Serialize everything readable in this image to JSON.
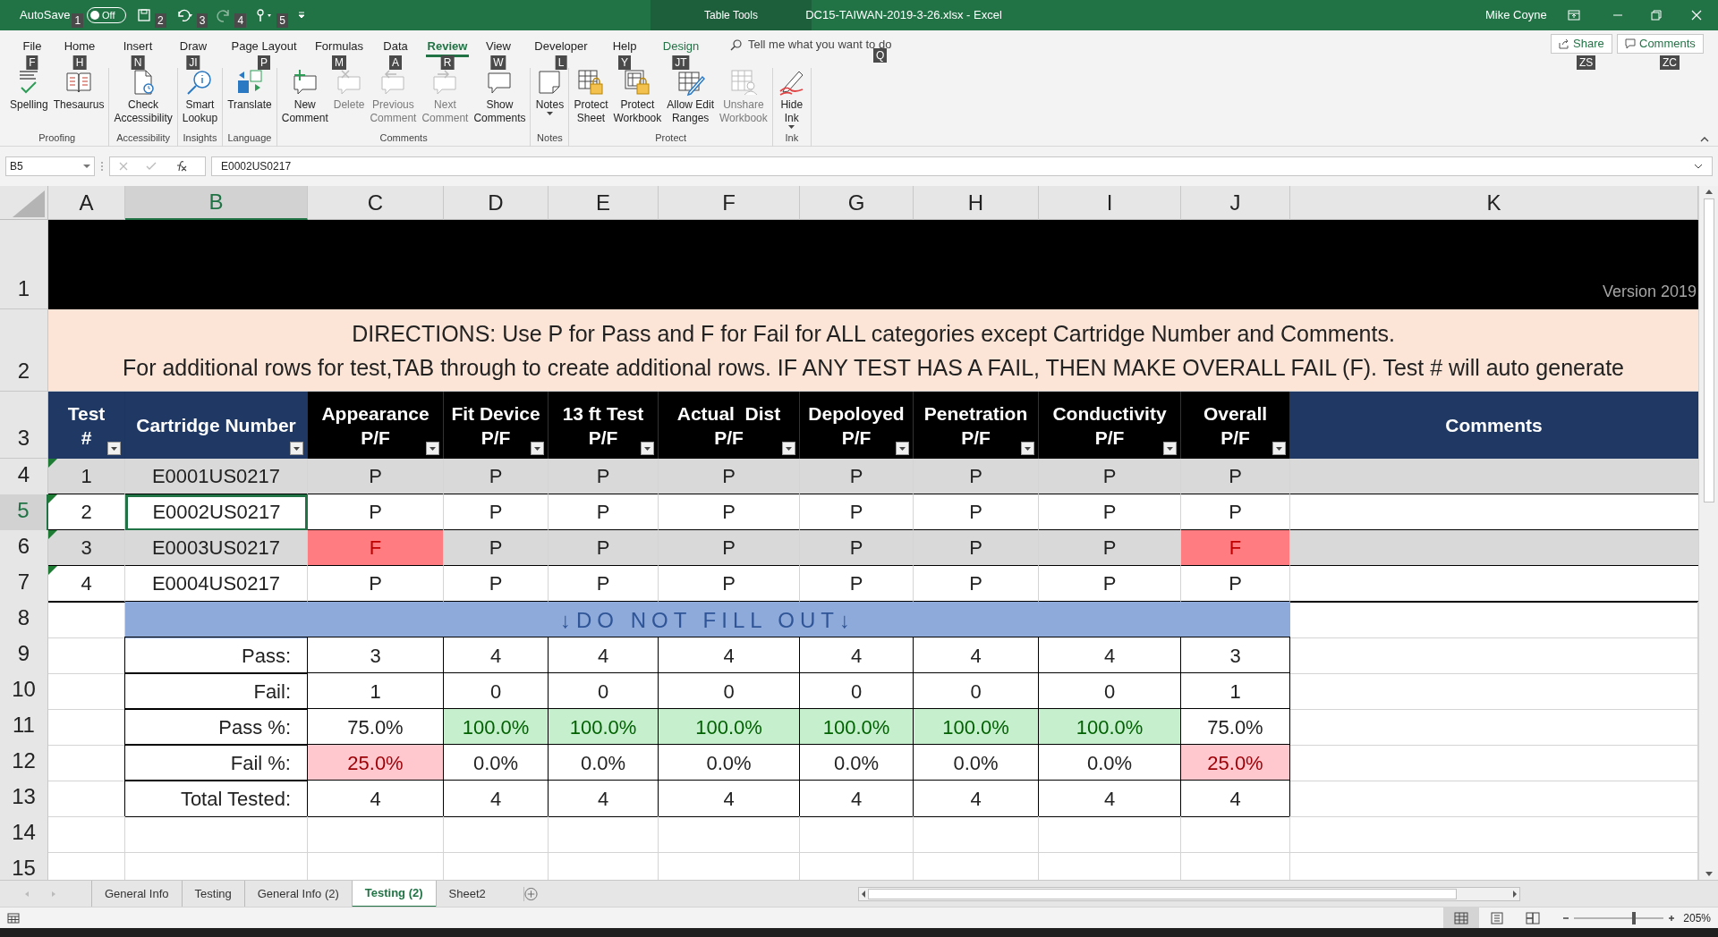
{
  "title_bar": {
    "autosave_label": "AutoSave",
    "autosave_state": "Off",
    "autosave_on": false,
    "qat_keys": [
      "1",
      "2",
      "3",
      "4",
      "5"
    ],
    "context_label": "Table Tools",
    "title": "DC15-TAIWAN-2019-3-26.xlsx  -  Excel",
    "user": "Mike Coyne"
  },
  "ribbon_tabs": [
    {
      "label": "File",
      "key": "F",
      "selected": false,
      "contextual": false
    },
    {
      "label": "Home",
      "key": "H",
      "selected": false,
      "contextual": false
    },
    {
      "label": "Insert",
      "key": "N",
      "selected": false,
      "contextual": false
    },
    {
      "label": "Draw",
      "key": "JI",
      "selected": false,
      "contextual": false
    },
    {
      "label": "Page Layout",
      "key": "P",
      "selected": false,
      "contextual": false
    },
    {
      "label": "Formulas",
      "key": "M",
      "selected": false,
      "contextual": false
    },
    {
      "label": "Data",
      "key": "A",
      "selected": false,
      "contextual": false
    },
    {
      "label": "Review",
      "key": "R",
      "selected": true,
      "contextual": false
    },
    {
      "label": "View",
      "key": "W",
      "selected": false,
      "contextual": false
    },
    {
      "label": "Developer",
      "key": "L",
      "selected": false,
      "contextual": false
    },
    {
      "label": "Help",
      "key": "Y",
      "selected": false,
      "contextual": false
    },
    {
      "label": "Design",
      "key": "JT",
      "selected": false,
      "contextual": true
    }
  ],
  "tell_me": {
    "placeholder": "Tell me what you want to do",
    "key": "Q"
  },
  "share": {
    "label": "Share",
    "key": "ZS"
  },
  "comments_button": {
    "label": "Comments",
    "key": "ZC"
  },
  "ribbon_groups": [
    {
      "label": "Proofing",
      "buttons": [
        {
          "label": "Spelling",
          "disabled": false,
          "dropdown": false
        },
        {
          "label": "Thesaurus",
          "disabled": false,
          "dropdown": false
        }
      ]
    },
    {
      "label": "Accessibility",
      "buttons": [
        {
          "label": "Check\nAccessibility",
          "disabled": false,
          "dropdown": false
        }
      ]
    },
    {
      "label": "Insights",
      "buttons": [
        {
          "label": "Smart\nLookup",
          "disabled": false,
          "dropdown": false
        }
      ]
    },
    {
      "label": "Language",
      "buttons": [
        {
          "label": "Translate",
          "disabled": false,
          "dropdown": false
        }
      ]
    },
    {
      "label": "Comments",
      "buttons": [
        {
          "label": "New\nComment",
          "disabled": false,
          "dropdown": false
        },
        {
          "label": "Delete",
          "disabled": true,
          "dropdown": false
        },
        {
          "label": "Previous\nComment",
          "disabled": true,
          "dropdown": false
        },
        {
          "label": "Next\nComment",
          "disabled": true,
          "dropdown": false
        },
        {
          "label": "Show\nComments",
          "disabled": false,
          "dropdown": false
        }
      ]
    },
    {
      "label": "Notes",
      "buttons": [
        {
          "label": "Notes",
          "disabled": false,
          "dropdown": true
        }
      ]
    },
    {
      "label": "Protect",
      "buttons": [
        {
          "label": "Protect\nSheet",
          "disabled": false,
          "dropdown": false
        },
        {
          "label": "Protect\nWorkbook",
          "disabled": false,
          "dropdown": false
        },
        {
          "label": "Allow Edit\nRanges",
          "disabled": false,
          "dropdown": false
        },
        {
          "label": "Unshare\nWorkbook",
          "disabled": true,
          "dropdown": false
        }
      ]
    },
    {
      "label": "Ink",
      "buttons": [
        {
          "label": "Hide\nInk",
          "disabled": false,
          "dropdown": true
        }
      ]
    }
  ],
  "formula_bar": {
    "name_box": "B5",
    "formula": "E0002US0217"
  },
  "columns": [
    {
      "label": "A",
      "selected": false
    },
    {
      "label": "B",
      "selected": true
    },
    {
      "label": "C",
      "selected": false
    },
    {
      "label": "D",
      "selected": false
    },
    {
      "label": "E",
      "selected": false
    },
    {
      "label": "F",
      "selected": false
    },
    {
      "label": "G",
      "selected": false
    },
    {
      "label": "H",
      "selected": false
    },
    {
      "label": "I",
      "selected": false
    },
    {
      "label": "J",
      "selected": false
    },
    {
      "label": "K",
      "selected": false
    }
  ],
  "row_numbers": [
    {
      "label": "1",
      "selected": false
    },
    {
      "label": "2",
      "selected": false
    },
    {
      "label": "3",
      "selected": false
    },
    {
      "label": "4",
      "selected": false
    },
    {
      "label": "5",
      "selected": true
    },
    {
      "label": "6",
      "selected": false
    },
    {
      "label": "7",
      "selected": false
    },
    {
      "label": "8",
      "selected": false
    },
    {
      "label": "9",
      "selected": false
    },
    {
      "label": "10",
      "selected": false
    },
    {
      "label": "11",
      "selected": false
    },
    {
      "label": "12",
      "selected": false
    },
    {
      "label": "13",
      "selected": false
    },
    {
      "label": "14",
      "selected": false
    },
    {
      "label": "15",
      "selected": false
    }
  ],
  "version": "Version 2019",
  "directions": [
    "DIRECTIONS: Use P for Pass and F for Fail for ALL categories except Cartridge Number and Comments.",
    "For additional rows for test,TAB through to create additional rows. IF ANY TEST HAS A FAIL, THEN MAKE OVERALL FAIL (F). Test # will auto generate"
  ],
  "table_headers": [
    {
      "lines": [
        "Test",
        "#"
      ],
      "color": "#1f3864",
      "filter": true
    },
    {
      "lines": [
        "Cartridge Number"
      ],
      "color": "#1f3864",
      "filter": true
    },
    {
      "lines": [
        "Appearance",
        "P/F"
      ],
      "color": "#000000",
      "filter": true
    },
    {
      "lines": [
        "Fit Device",
        "P/F"
      ],
      "color": "#000000",
      "filter": true
    },
    {
      "lines": [
        "13 ft Test",
        "P/F"
      ],
      "color": "#000000",
      "filter": true
    },
    {
      "lines": [
        "Actual  Dist",
        "P/F"
      ],
      "color": "#000000",
      "filter": true
    },
    {
      "lines": [
        "Depoloyed",
        "P/F"
      ],
      "color": "#000000",
      "filter": true
    },
    {
      "lines": [
        "Penetration",
        "P/F"
      ],
      "color": "#000000",
      "filter": true
    },
    {
      "lines": [
        "Conductivity",
        "P/F"
      ],
      "color": "#000000",
      "filter": true
    },
    {
      "lines": [
        "Overall",
        "P/F"
      ],
      "color": "#000000",
      "filter": true
    },
    {
      "lines": [
        "Comments"
      ],
      "color": "#1f3864",
      "filter": false
    }
  ],
  "rows": [
    {
      "test": "1",
      "cartridge": "E0001US0217",
      "banded": true,
      "results": [
        {
          "text": "P",
          "fail": false
        },
        {
          "text": "P",
          "fail": false
        },
        {
          "text": "P",
          "fail": false
        },
        {
          "text": "P",
          "fail": false
        },
        {
          "text": "P",
          "fail": false
        },
        {
          "text": "P",
          "fail": false
        },
        {
          "text": "P",
          "fail": false
        },
        {
          "text": "P",
          "fail": false
        }
      ]
    },
    {
      "test": "2",
      "cartridge": "E0002US0217",
      "banded": false,
      "results": [
        {
          "text": "P",
          "fail": false
        },
        {
          "text": "P",
          "fail": false
        },
        {
          "text": "P",
          "fail": false
        },
        {
          "text": "P",
          "fail": false
        },
        {
          "text": "P",
          "fail": false
        },
        {
          "text": "P",
          "fail": false
        },
        {
          "text": "P",
          "fail": false
        },
        {
          "text": "P",
          "fail": false
        }
      ]
    },
    {
      "test": "3",
      "cartridge": "E0003US0217",
      "banded": true,
      "results": [
        {
          "text": "F",
          "fail": true
        },
        {
          "text": "P",
          "fail": false
        },
        {
          "text": "P",
          "fail": false
        },
        {
          "text": "P",
          "fail": false
        },
        {
          "text": "P",
          "fail": false
        },
        {
          "text": "P",
          "fail": false
        },
        {
          "text": "P",
          "fail": false
        },
        {
          "text": "F",
          "fail": true
        }
      ]
    },
    {
      "test": "4",
      "cartridge": "E0004US0217",
      "banded": false,
      "results": [
        {
          "text": "P",
          "fail": false
        },
        {
          "text": "P",
          "fail": false
        },
        {
          "text": "P",
          "fail": false
        },
        {
          "text": "P",
          "fail": false
        },
        {
          "text": "P",
          "fail": false
        },
        {
          "text": "P",
          "fail": false
        },
        {
          "text": "P",
          "fail": false
        },
        {
          "text": "P",
          "fail": false
        }
      ]
    }
  ],
  "do_not_fill": "↓DO NOT FILL OUT↓",
  "summary": [
    {
      "label": "Pass:",
      "values": [
        {
          "text": "3"
        },
        {
          "text": "4"
        },
        {
          "text": "4"
        },
        {
          "text": "4"
        },
        {
          "text": "4"
        },
        {
          "text": "4"
        },
        {
          "text": "4"
        },
        {
          "text": "3"
        }
      ]
    },
    {
      "label": "Fail:",
      "values": [
        {
          "text": "1"
        },
        {
          "text": "0"
        },
        {
          "text": "0"
        },
        {
          "text": "0"
        },
        {
          "text": "0"
        },
        {
          "text": "0"
        },
        {
          "text": "0"
        },
        {
          "text": "1"
        }
      ]
    },
    {
      "label": "Pass %:",
      "values": [
        {
          "text": "75.0%"
        },
        {
          "text": "100.0%",
          "color": "#c6efce"
        },
        {
          "text": "100.0%",
          "color": "#c6efce"
        },
        {
          "text": "100.0%",
          "color": "#c6efce"
        },
        {
          "text": "100.0%",
          "color": "#c6efce"
        },
        {
          "text": "100.0%",
          "color": "#c6efce"
        },
        {
          "text": "100.0%",
          "color": "#c6efce"
        },
        {
          "text": "75.0%"
        }
      ]
    },
    {
      "label": "Fail %:",
      "values": [
        {
          "text": "25.0%",
          "color": "#ffc7ce"
        },
        {
          "text": "0.0%"
        },
        {
          "text": "0.0%"
        },
        {
          "text": "0.0%"
        },
        {
          "text": "0.0%"
        },
        {
          "text": "0.0%"
        },
        {
          "text": "0.0%"
        },
        {
          "text": "25.0%",
          "color": "#ffc7ce"
        }
      ]
    },
    {
      "label": "Total Tested:",
      "values": [
        {
          "text": "4"
        },
        {
          "text": "4"
        },
        {
          "text": "4"
        },
        {
          "text": "4"
        },
        {
          "text": "4"
        },
        {
          "text": "4"
        },
        {
          "text": "4"
        },
        {
          "text": "4"
        }
      ]
    }
  ],
  "sheet_tabs": [
    {
      "label": "General Info",
      "selected": false
    },
    {
      "label": "Testing",
      "selected": false
    },
    {
      "label": "General Info (2)",
      "selected": false
    },
    {
      "label": "Testing (2)",
      "selected": true
    },
    {
      "label": "Sheet2",
      "selected": false
    }
  ],
  "status_bar": {
    "views": [
      {
        "selected": true
      },
      {
        "selected": false
      },
      {
        "selected": false
      }
    ],
    "zoom": {
      "level": 0.67
    },
    "zoom_label": "205%"
  }
}
